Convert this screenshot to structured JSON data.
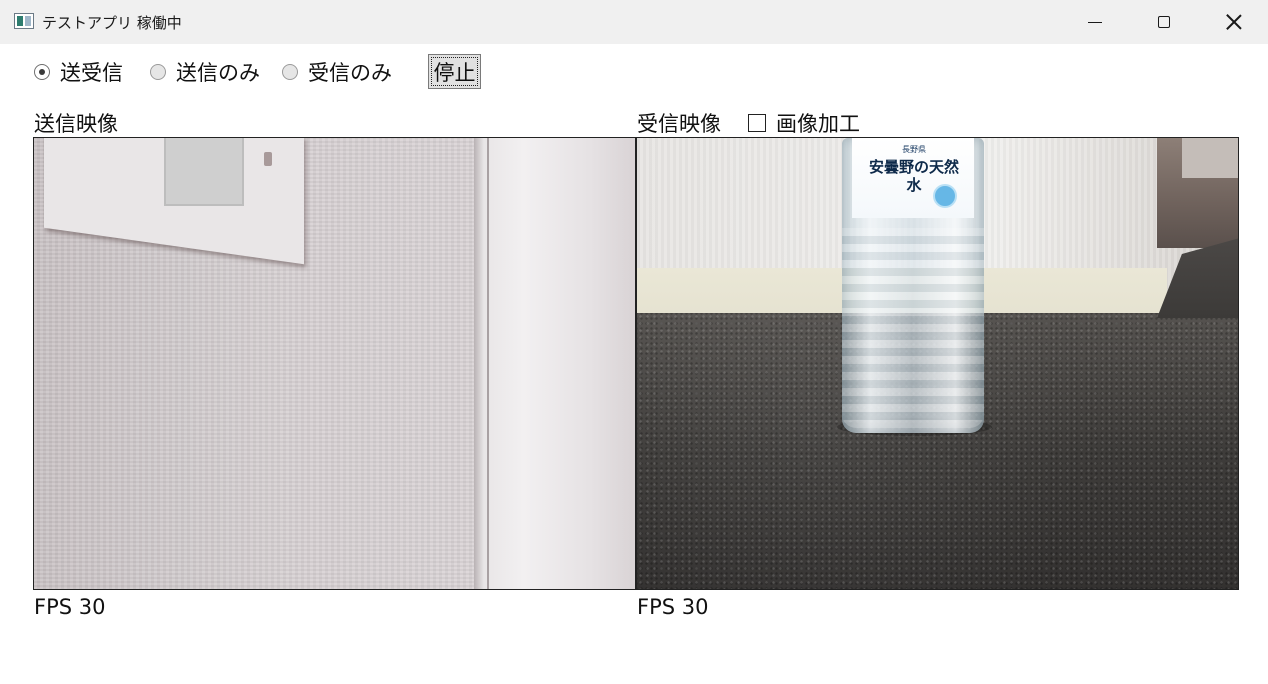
{
  "window": {
    "title": "テストアプリ 稼働中",
    "app_icon": "app-icon",
    "controls": {
      "minimize_icon": "minimize-icon",
      "maximize_icon": "maximize-icon",
      "close_icon": "close-icon"
    }
  },
  "mode": {
    "options": [
      {
        "label": "送受信",
        "selected": true
      },
      {
        "label": "送信のみ",
        "selected": false
      },
      {
        "label": "受信のみ",
        "selected": false
      }
    ],
    "stop_label": "停止"
  },
  "send": {
    "label": "送信映像",
    "fps_text": "FPS 30"
  },
  "receive": {
    "label": "受信映像",
    "process_label": "画像加工",
    "process_checked": false,
    "fps_text": "FPS 30",
    "bottle_label": {
      "small": "長野県",
      "title": "安曇野の天然水"
    }
  }
}
